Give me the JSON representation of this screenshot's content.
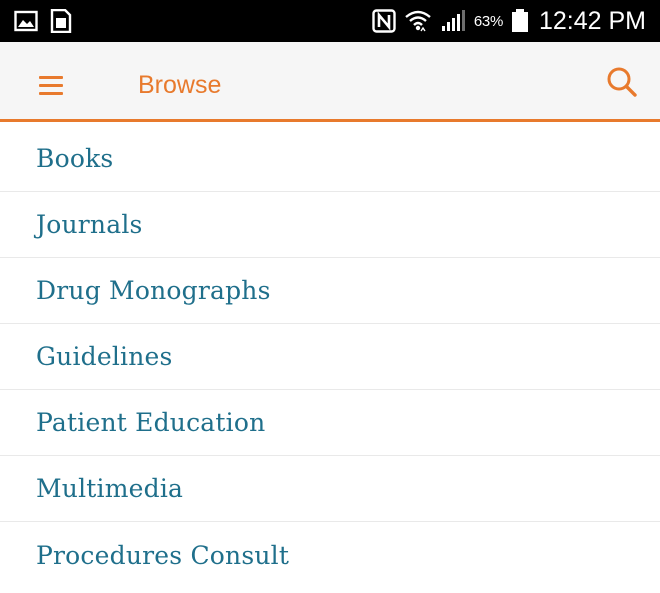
{
  "status_bar": {
    "battery_percent": "63%",
    "time": "12:42 PM",
    "icons": [
      "image-notification-icon",
      "sim-notification-icon",
      "nfc-icon",
      "wifi-icon",
      "signal-icon",
      "battery-icon"
    ]
  },
  "app_bar": {
    "title": "Browse",
    "menu_icon": "hamburger-menu-icon",
    "search_icon": "search-icon",
    "accent_color": "#e87a2d"
  },
  "browse": {
    "link_color": "#1f6f8b",
    "items": [
      {
        "label": "Books"
      },
      {
        "label": "Journals"
      },
      {
        "label": "Drug Monographs"
      },
      {
        "label": "Guidelines"
      },
      {
        "label": "Patient Education"
      },
      {
        "label": "Multimedia"
      },
      {
        "label": "Procedures Consult"
      }
    ]
  }
}
